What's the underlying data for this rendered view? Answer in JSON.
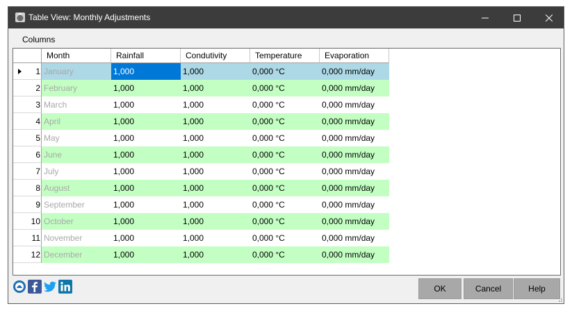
{
  "window": {
    "title": "Table View: Monthly Adjustments",
    "icon": "app-icon",
    "controls": [
      "minimize-icon",
      "maximize-icon",
      "close-icon"
    ]
  },
  "menu": {
    "columns_label": "Columns"
  },
  "table": {
    "headers": [
      "Month",
      "Rainfall",
      "Condutivity",
      "Temperature",
      "Evaporation"
    ],
    "rows": [
      {
        "num": "1",
        "month": "January",
        "rainfall": "1,000",
        "conductivity": "1,000",
        "temperature": "0,000 °C",
        "evaporation": "0,000 mm/day"
      },
      {
        "num": "2",
        "month": "February",
        "rainfall": "1,000",
        "conductivity": "1,000",
        "temperature": "0,000 °C",
        "evaporation": "0,000 mm/day"
      },
      {
        "num": "3",
        "month": "March",
        "rainfall": "1,000",
        "conductivity": "1,000",
        "temperature": "0,000 °C",
        "evaporation": "0,000 mm/day"
      },
      {
        "num": "4",
        "month": "April",
        "rainfall": "1,000",
        "conductivity": "1,000",
        "temperature": "0,000 °C",
        "evaporation": "0,000 mm/day"
      },
      {
        "num": "5",
        "month": "May",
        "rainfall": "1,000",
        "conductivity": "1,000",
        "temperature": "0,000 °C",
        "evaporation": "0,000 mm/day"
      },
      {
        "num": "6",
        "month": "June",
        "rainfall": "1,000",
        "conductivity": "1,000",
        "temperature": "0,000 °C",
        "evaporation": "0,000 mm/day"
      },
      {
        "num": "7",
        "month": "July",
        "rainfall": "1,000",
        "conductivity": "1,000",
        "temperature": "0,000 °C",
        "evaporation": "0,000 mm/day"
      },
      {
        "num": "8",
        "month": "August",
        "rainfall": "1,000",
        "conductivity": "1,000",
        "temperature": "0,000 °C",
        "evaporation": "0,000 mm/day"
      },
      {
        "num": "9",
        "month": "September",
        "rainfall": "1,000",
        "conductivity": "1,000",
        "temperature": "0,000 °C",
        "evaporation": "0,000 mm/day"
      },
      {
        "num": "10",
        "month": "October",
        "rainfall": "1,000",
        "conductivity": "1,000",
        "temperature": "0,000 °C",
        "evaporation": "0,000 mm/day"
      },
      {
        "num": "11",
        "month": "November",
        "rainfall": "1,000",
        "conductivity": "1,000",
        "temperature": "0,000 °C",
        "evaporation": "0,000 mm/day"
      },
      {
        "num": "12",
        "month": "December",
        "rainfall": "1,000",
        "conductivity": "1,000",
        "temperature": "0,000 °C",
        "evaporation": "0,000 mm/day"
      }
    ]
  },
  "footer": {
    "social_icons": [
      "app-logo-icon",
      "facebook-icon",
      "twitter-icon",
      "linkedin-icon"
    ],
    "ok_label": "OK",
    "cancel_label": "Cancel",
    "help_label": "Help"
  },
  "colors": {
    "titlebar": "#3c3c3c",
    "row_alt": "#c3ffc3",
    "row_selected": "#add8e6",
    "cell_active": "#0078d7",
    "button": "#a8a8a8"
  }
}
